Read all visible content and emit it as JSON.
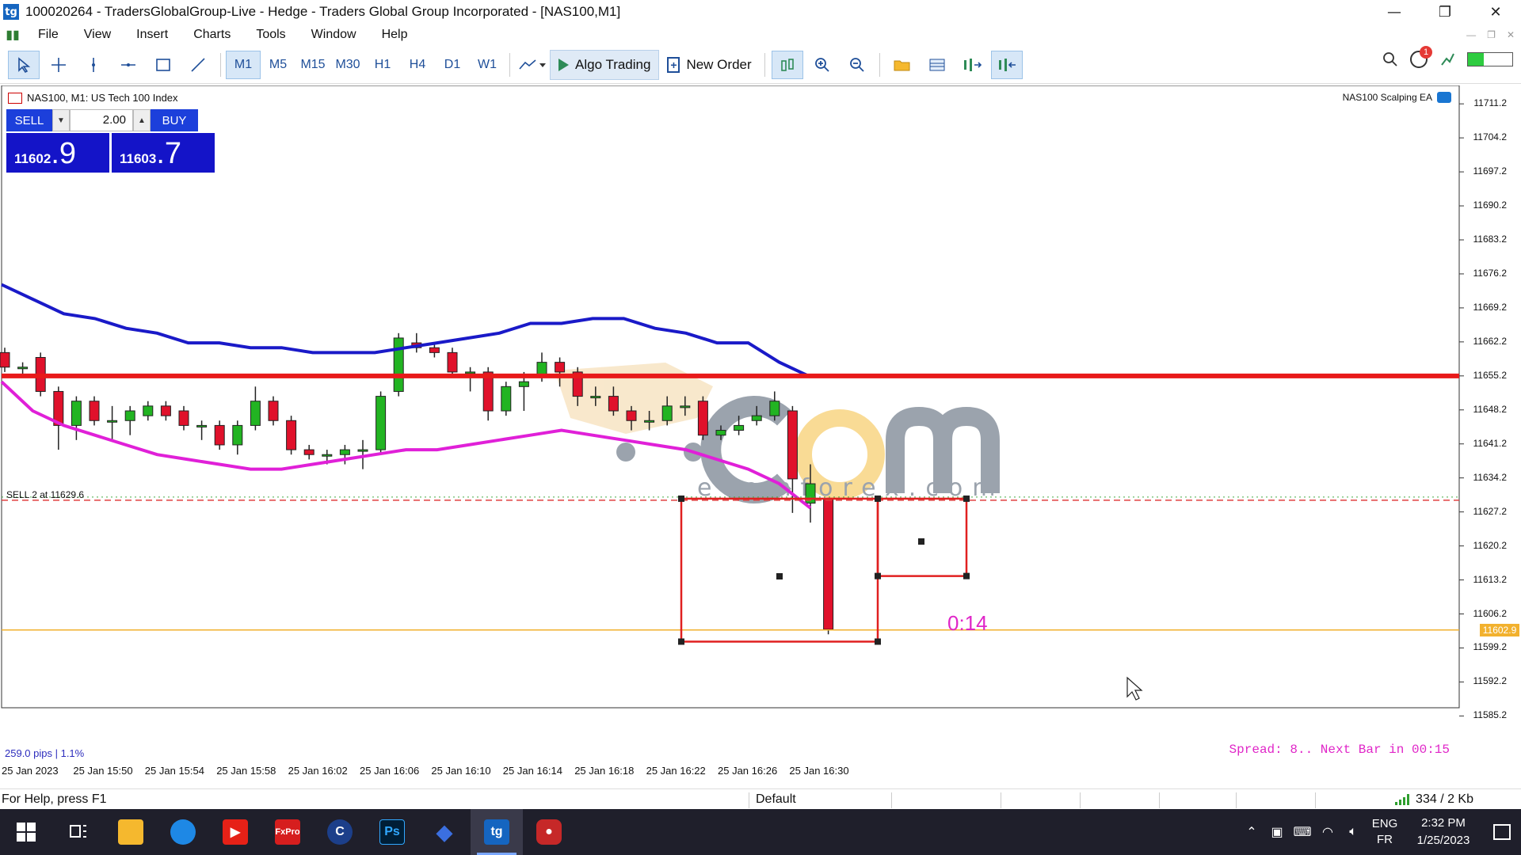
{
  "window": {
    "title": "100020264 - TradersGlobalGroup-Live - Hedge - Traders Global Group Incorporated - [NAS100,M1]",
    "app_icon": "tg",
    "minimize": "—",
    "restore": "❐",
    "close": "✕"
  },
  "menu": {
    "items": [
      "File",
      "View",
      "Insert",
      "Charts",
      "Tools",
      "Window",
      "Help"
    ]
  },
  "toolbar": {
    "timeframes": [
      "M1",
      "M5",
      "M15",
      "M30",
      "H1",
      "H4",
      "D1",
      "W1"
    ],
    "active_timeframe": "M1",
    "algo_trading": "Algo Trading",
    "new_order": "New Order",
    "notifications_count": "1",
    "signal_strength": 0.35
  },
  "chart": {
    "symbol_label": "NAS100, M1:  US Tech 100 Index",
    "ea_label": "NAS100 Scalping EA",
    "trade_panel": {
      "sell_label": "SELL",
      "buy_label": "BUY",
      "lot": "2.00",
      "bid_main": "11602",
      "bid_big": ".9",
      "ask_main": "11603",
      "ask_big": ".7"
    },
    "sell_line_label": "SELL 2 at 11629.6",
    "countdown": "0:14",
    "pips_label": "259.0 pips | 1.1%",
    "spread_label": "Spread: 8.. Next Bar in 00:15",
    "current_price_tag": "11602.9",
    "watermark_url": "ecomforex.com",
    "price_axis": [
      "11711.2",
      "11704.2",
      "11697.2",
      "11690.2",
      "11683.2",
      "11676.2",
      "11669.2",
      "11662.2",
      "11655.2",
      "11648.2",
      "11641.2",
      "11634.2",
      "11627.2",
      "11620.2",
      "11613.2",
      "11606.2",
      "11599.2",
      "11592.2",
      "11585.2"
    ],
    "time_axis": [
      "25 Jan 2023",
      "25 Jan 15:50",
      "25 Jan 15:54",
      "25 Jan 15:58",
      "25 Jan 16:02",
      "25 Jan 16:06",
      "25 Jan 16:10",
      "25 Jan 16:14",
      "25 Jan 16:18",
      "25 Jan 16:22",
      "25 Jan 16:26",
      "25 Jan 16:30"
    ],
    "colors": {
      "bull": "#22b422",
      "bear": "#e0112b",
      "upper_band": "#1a1ac8",
      "lower_band": "#e020d8",
      "resistance": "#e81a1a",
      "bid_line": "#f2b12e"
    }
  },
  "chart_data": {
    "type": "line",
    "title": "NAS100, M1:  US Tech 100 Index",
    "ylim": [
      11582,
      11714
    ],
    "resistance_level": 11655.2,
    "sell_level": 11629.6,
    "bid_level": 11602.9,
    "candles": [
      {
        "o": 11660,
        "c": 11657,
        "h": 11661,
        "l": 11656
      },
      {
        "o": 11657,
        "c": 11657,
        "h": 11658,
        "l": 11655
      },
      {
        "o": 11659,
        "c": 11652,
        "h": 11660,
        "l": 11651
      },
      {
        "o": 11652,
        "c": 11645,
        "h": 11653,
        "l": 11640
      },
      {
        "o": 11645,
        "c": 11650,
        "h": 11651,
        "l": 11642
      },
      {
        "o": 11650,
        "c": 11646,
        "h": 11651,
        "l": 11645
      },
      {
        "o": 11646,
        "c": 11646,
        "h": 11649,
        "l": 11642
      },
      {
        "o": 11646,
        "c": 11648,
        "h": 11649,
        "l": 11643
      },
      {
        "o": 11647,
        "c": 11649,
        "h": 11650,
        "l": 11646
      },
      {
        "o": 11649,
        "c": 11647,
        "h": 11650,
        "l": 11646
      },
      {
        "o": 11648,
        "c": 11645,
        "h": 11649,
        "l": 11644
      },
      {
        "o": 11645,
        "c": 11645,
        "h": 11646,
        "l": 11642
      },
      {
        "o": 11645,
        "c": 11641,
        "h": 11646,
        "l": 11640
      },
      {
        "o": 11641,
        "c": 11645,
        "h": 11646,
        "l": 11639
      },
      {
        "o": 11645,
        "c": 11650,
        "h": 11653,
        "l": 11644
      },
      {
        "o": 11650,
        "c": 11646,
        "h": 11651,
        "l": 11645
      },
      {
        "o": 11646,
        "c": 11640,
        "h": 11647,
        "l": 11639
      },
      {
        "o": 11640,
        "c": 11639,
        "h": 11641,
        "l": 11638
      },
      {
        "o": 11639,
        "c": 11639,
        "h": 11640,
        "l": 11637
      },
      {
        "o": 11639,
        "c": 11640,
        "h": 11641,
        "l": 11637
      },
      {
        "o": 11640,
        "c": 11640,
        "h": 11642,
        "l": 11636
      },
      {
        "o": 11640,
        "c": 11651,
        "h": 11652,
        "l": 11639
      },
      {
        "o": 11652,
        "c": 11663,
        "h": 11664,
        "l": 11651
      },
      {
        "o": 11662,
        "c": 11661,
        "h": 11664,
        "l": 11660
      },
      {
        "o": 11661,
        "c": 11660,
        "h": 11662,
        "l": 11659
      },
      {
        "o": 11660,
        "c": 11656,
        "h": 11661,
        "l": 11655
      },
      {
        "o": 11656,
        "c": 11656,
        "h": 11657,
        "l": 11652
      },
      {
        "o": 11656,
        "c": 11648,
        "h": 11657,
        "l": 11646
      },
      {
        "o": 11648,
        "c": 11653,
        "h": 11654,
        "l": 11647
      },
      {
        "o": 11653,
        "c": 11654,
        "h": 11656,
        "l": 11648
      },
      {
        "o": 11655,
        "c": 11658,
        "h": 11660,
        "l": 11654
      },
      {
        "o": 11658,
        "c": 11656,
        "h": 11659,
        "l": 11653
      },
      {
        "o": 11656,
        "c": 11651,
        "h": 11657,
        "l": 11649
      },
      {
        "o": 11651,
        "c": 11651,
        "h": 11653,
        "l": 11649
      },
      {
        "o": 11651,
        "c": 11648,
        "h": 11653,
        "l": 11647
      },
      {
        "o": 11648,
        "c": 11646,
        "h": 11649,
        "l": 11644
      },
      {
        "o": 11646,
        "c": 11646,
        "h": 11648,
        "l": 11644
      },
      {
        "o": 11646,
        "c": 11649,
        "h": 11651,
        "l": 11645
      },
      {
        "o": 11649,
        "c": 11649,
        "h": 11651,
        "l": 11647
      },
      {
        "o": 11650,
        "c": 11643,
        "h": 11651,
        "l": 11642
      },
      {
        "o": 11643,
        "c": 11644,
        "h": 11645,
        "l": 11642
      },
      {
        "o": 11644,
        "c": 11645,
        "h": 11647,
        "l": 11643
      },
      {
        "o": 11646,
        "c": 11647,
        "h": 11649,
        "l": 11645
      },
      {
        "o": 11647,
        "c": 11650,
        "h": 11652,
        "l": 11646
      },
      {
        "o": 11648,
        "c": 11634,
        "h": 11649,
        "l": 11627
      },
      {
        "o": 11629,
        "c": 11633,
        "h": 11637,
        "l": 11625
      },
      {
        "o": 11630,
        "c": 11603,
        "h": 11630,
        "l": 11602
      }
    ],
    "series": [
      {
        "name": "",
        "values": [
          11674,
          11671,
          11668,
          11667,
          11665,
          11664,
          11662,
          11662,
          11661,
          11661,
          11660,
          11660,
          11660,
          11661,
          11662,
          11663,
          11664,
          11666,
          11666,
          11667,
          11667,
          11665,
          11664,
          11662,
          11662,
          11658,
          11655
        ]
      },
      {
        "name": "",
        "values": [
          11654,
          11648,
          11645,
          11643,
          11641,
          11639,
          11638,
          11637,
          11636,
          11636,
          11637,
          11638,
          11639,
          11640,
          11640,
          11641,
          11642,
          11643,
          11644,
          11643,
          11642,
          11641,
          11640,
          11638,
          11636,
          11633,
          11628
        ]
      }
    ]
  },
  "status": {
    "help": "For Help, press F1",
    "profile": "Default",
    "net": "334 / 2 Kb"
  },
  "taskbar": {
    "lang_top": "ENG",
    "lang_bottom": "FR",
    "time": "2:32 PM",
    "date": "1/25/2023"
  }
}
